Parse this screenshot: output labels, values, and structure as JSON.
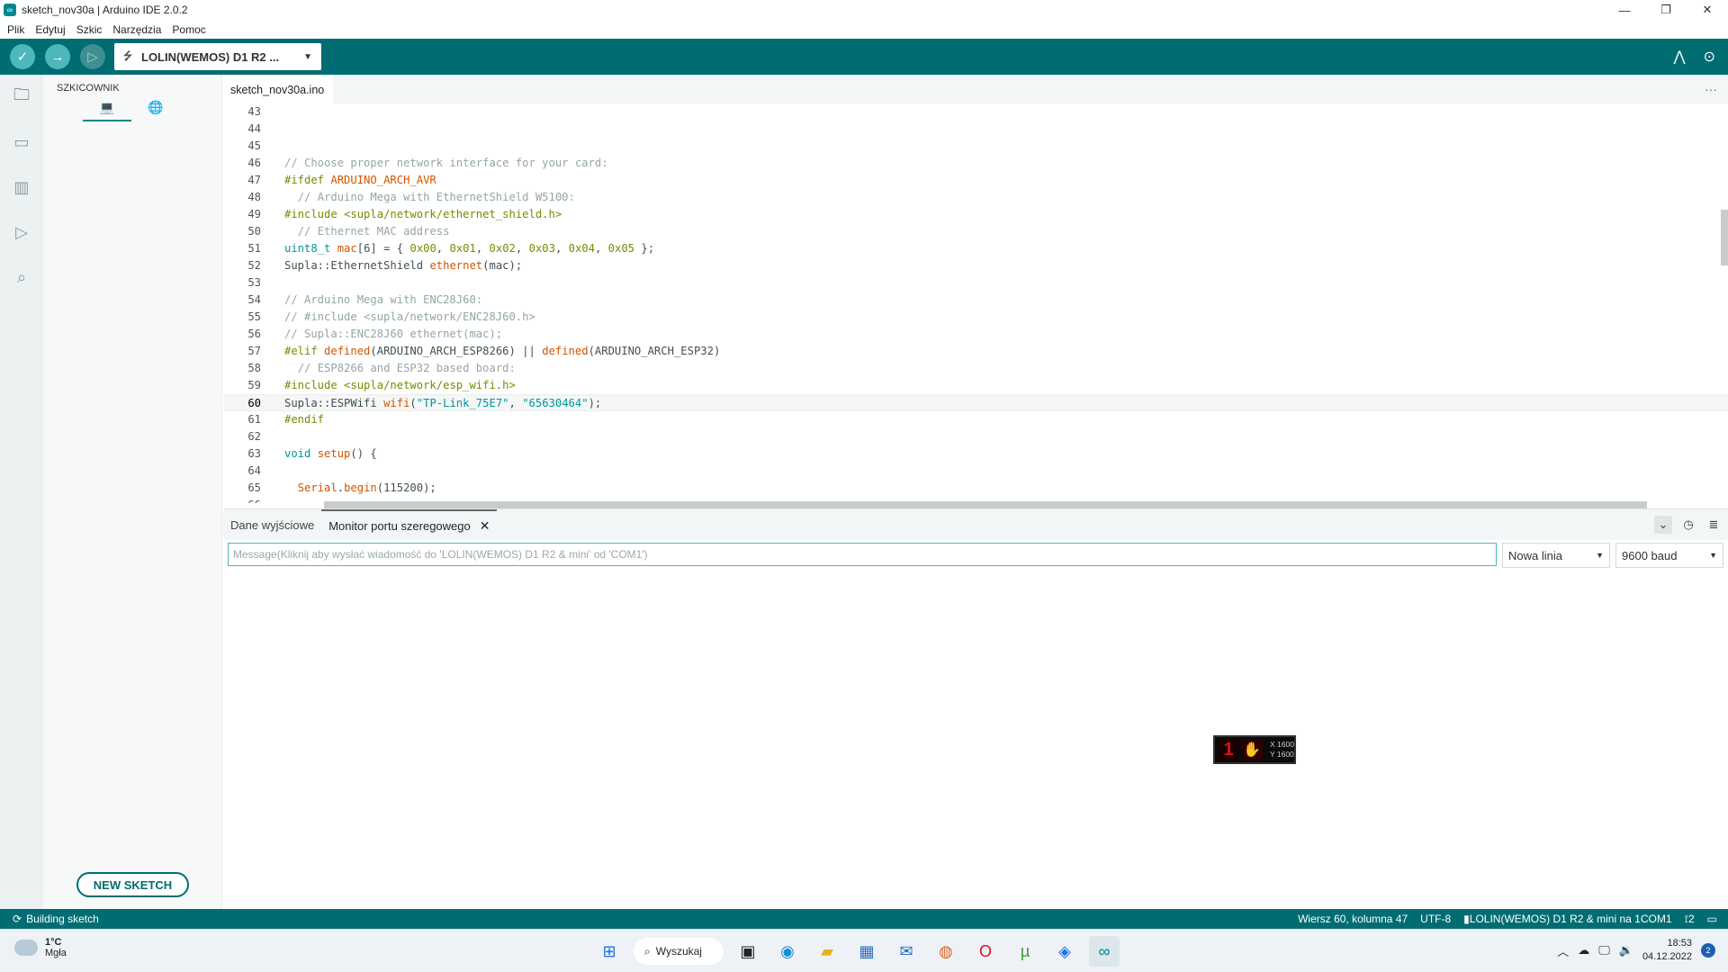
{
  "window": {
    "title": "sketch_nov30a | Arduino IDE 2.0.2"
  },
  "menu": [
    "Plik",
    "Edytuj",
    "Szkic",
    "Narzędzia",
    "Pomoc"
  ],
  "toolbar": {
    "board": "LOLIN(WEMOS) D1 R2 ..."
  },
  "sidebar": {
    "header": "SZKICOWNIK",
    "new_sketch": "NEW SKETCH"
  },
  "editor": {
    "tab": "sketch_nov30a.ino",
    "current_line": 60,
    "lines": [
      {
        "n": "43",
        "html": ""
      },
      {
        "n": "44",
        "html": ""
      },
      {
        "n": "45",
        "html": ""
      },
      {
        "n": "46",
        "html": "<span class='c-com'>// Choose proper network interface for your card:</span>"
      },
      {
        "n": "47",
        "html": "<span class='c-pre'>#ifdef</span> <span class='c-def'>ARDUINO_ARCH_AVR</span>"
      },
      {
        "n": "48",
        "html": "  <span class='c-com'>// Arduino Mega with EthernetShield W5100:</span>"
      },
      {
        "n": "49",
        "html": "<span class='c-pre'>#include</span> <span class='c-pre'>&lt;supla/network/ethernet_shield.h&gt;</span>"
      },
      {
        "n": "50",
        "html": "  <span class='c-com'>// Ethernet MAC address</span>"
      },
      {
        "n": "51",
        "html": "<span class='c-kw'>uint8_t</span> <span class='c-fn'>mac</span>[6] = { <span class='c-pre'>0x00</span>, <span class='c-pre'>0x01</span>, <span class='c-pre'>0x02</span>, <span class='c-pre'>0x03</span>, <span class='c-pre'>0x04</span>, <span class='c-pre'>0x05</span> };"
      },
      {
        "n": "52",
        "html": "Supla::EthernetShield <span class='c-fn'>ethernet</span>(mac);"
      },
      {
        "n": "53",
        "html": ""
      },
      {
        "n": "54",
        "html": "<span class='c-com'>// Arduino Mega with ENC28J60:</span>"
      },
      {
        "n": "55",
        "html": "<span class='c-com'>// #include &lt;supla/network/ENC28J60.h&gt;</span>"
      },
      {
        "n": "56",
        "html": "<span class='c-com'>// Supla::ENC28J60 ethernet(mac);</span>"
      },
      {
        "n": "57",
        "html": "<span class='c-pre'>#elif</span> <span class='c-fn'>defined</span>(ARDUINO_ARCH_ESP8266) || <span class='c-fn'>defined</span>(ARDUINO_ARCH_ESP32)"
      },
      {
        "n": "58",
        "html": "  <span class='c-com'>// ESP8266 and ESP32 based board:</span>"
      },
      {
        "n": "59",
        "html": "<span class='c-pre'>#include</span> <span class='c-pre'>&lt;supla/network/esp_wifi.h&gt;</span>"
      },
      {
        "n": "60",
        "html": "Supla::ESPWifi <span class='c-fn'>wifi</span>(<span class='c-kw'>\"TP-Link_75E7\"</span>, <span class='c-kw'>\"65630464\"</span>);"
      },
      {
        "n": "61",
        "html": "<span class='c-pre'>#endif</span>"
      },
      {
        "n": "62",
        "html": ""
      },
      {
        "n": "63",
        "html": "<span class='c-kw'>void</span> <span class='c-fn'>setup</span>() {"
      },
      {
        "n": "64",
        "html": ""
      },
      {
        "n": "65",
        "html": "  <span class='c-fn'>Serial</span>.<span class='c-fn'>begin</span>(115200);"
      },
      {
        "n": "66",
        "html": ""
      }
    ]
  },
  "panel": {
    "tab_output": "Dane wyjściowe",
    "tab_serial": "Monitor portu szeregowego",
    "message_placeholder": "Message(Kliknij aby wysłać wiadomość do 'LOLIN(WEMOS) D1 R2 & mini' od 'COM1')",
    "line_ending": "Nowa linia",
    "baud": "9600 baud",
    "overlay": {
      "x": "X 1600",
      "y": "Y 1600"
    }
  },
  "status": {
    "building": "Building sketch",
    "position": "Wiersz 60, kolumna 47",
    "encoding": "UTF-8",
    "board_port": "LOLIN(WEMOS) D1 R2 & mini na 1COM1",
    "notifications": "2"
  },
  "taskbar": {
    "temperature": "1°C",
    "weather": "Mgła",
    "search": "Wyszukaj",
    "time": "18:53",
    "date": "04.12.2022",
    "badge": "2"
  },
  "colors": {
    "accent": "#006d72",
    "toolbar_button": "#4db7bb"
  }
}
